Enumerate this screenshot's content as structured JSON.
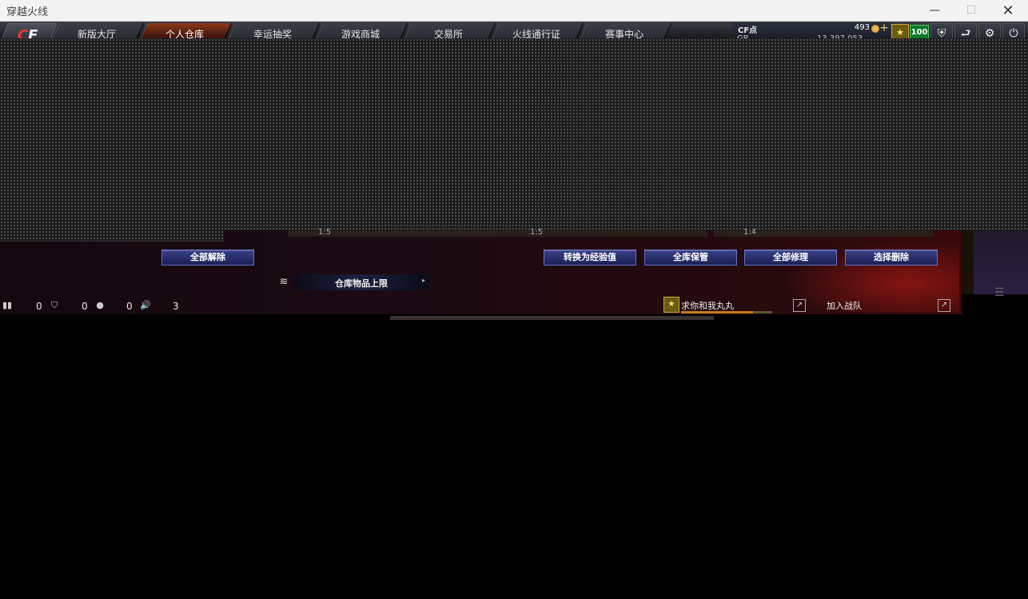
{
  "window": {
    "title": "穿越火线",
    "minimize_glyph": "—",
    "maximize_glyph": "☐",
    "close_glyph": "✕"
  },
  "nav": {
    "logo_left": "C",
    "logo_right": "F",
    "tabs": [
      {
        "label": "新版大厅"
      },
      {
        "label": "个人仓库"
      },
      {
        "label": "幸运抽奖"
      },
      {
        "label": "游戏商城"
      },
      {
        "label": "交易所"
      },
      {
        "label": "火线通行证"
      },
      {
        "label": "赛事中心"
      }
    ],
    "active_tab": "个人仓库"
  },
  "account": {
    "cf_points_label": "CF点",
    "cf_points_value": "493",
    "gp_label": "GP",
    "gp_value": "13,397,053",
    "plus_glyph": "+",
    "rank_badge": "★",
    "level": "100",
    "icons": [
      {
        "name": "shield-icon",
        "glyph": "⛨"
      },
      {
        "name": "exit-icon",
        "glyph": "⮐"
      },
      {
        "name": "gear-icon",
        "glyph": "⚙"
      },
      {
        "name": "power-icon",
        "glyph": "⏻"
      }
    ]
  },
  "slots": {
    "numbers": [
      "1:5",
      "1:5",
      "1:4"
    ]
  },
  "buttons": {
    "unlock_all": "全部解除",
    "convert_exp": "转换为经验值",
    "store_all": "全库保管",
    "repair_all": "全部修理",
    "select_delete": "选择删除"
  },
  "warehouse": {
    "limit_label": "仓库物品上限",
    "layers_glyph": "≋",
    "arrow_glyph": "▸"
  },
  "status": {
    "items": [
      {
        "name": "bag-icon",
        "glyph": "▮▮",
        "value": "0"
      },
      {
        "name": "shield-small-icon",
        "glyph": "⛉",
        "value": "0"
      },
      {
        "name": "chat-icon",
        "glyph": "●",
        "value": "0"
      },
      {
        "name": "speaker-icon",
        "glyph": "🔊",
        "value": "3"
      }
    ]
  },
  "team": {
    "badge": "★",
    "name": "求你和我丸丸",
    "share_glyph": "↗",
    "join_label": "加入战队",
    "menu_glyph": "☰"
  }
}
